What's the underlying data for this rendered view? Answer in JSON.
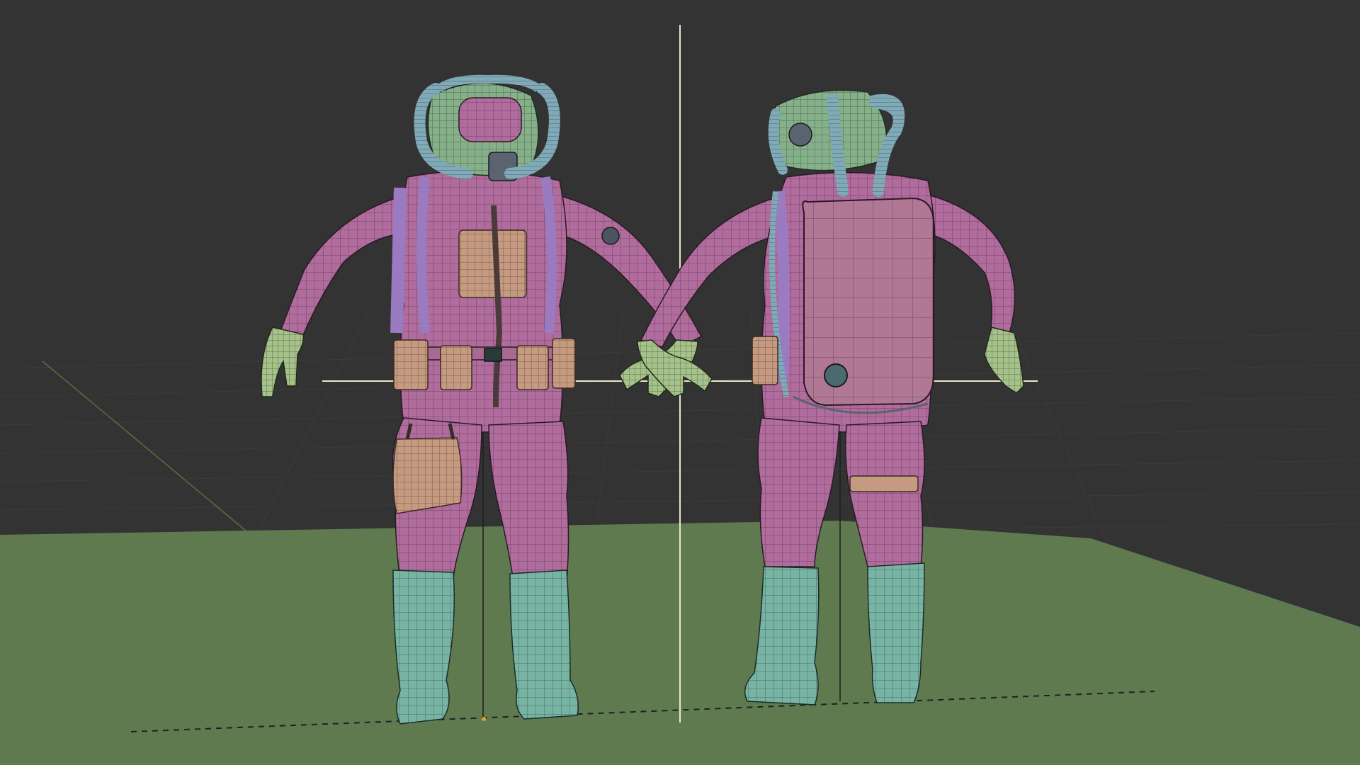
{
  "viewport": {
    "background_color": "#333333",
    "ground_color": "#5f7a4f",
    "grid_line_color": "#3f3f3f",
    "crosshair_color": "#e8e6c8",
    "axis_dashed_color": "#202020"
  },
  "figures": [
    {
      "view": "front",
      "suit_color": "#b06c9c",
      "boot_color": "#78b4a4",
      "glove_color": "#a6c28a",
      "helmet_color": "#86b08a",
      "hose_color": "#80aab8",
      "harness_color": "#9a7ac0",
      "pouch_color": "#c59a80"
    },
    {
      "view": "back",
      "suit_color": "#b06c9c",
      "boot_color": "#78b4a4",
      "glove_color": "#a6c28a",
      "helmet_color": "#86b08a",
      "hose_color": "#80aab8",
      "harness_color": "#9a7ac0",
      "backpack_color": "#b07894"
    }
  ]
}
